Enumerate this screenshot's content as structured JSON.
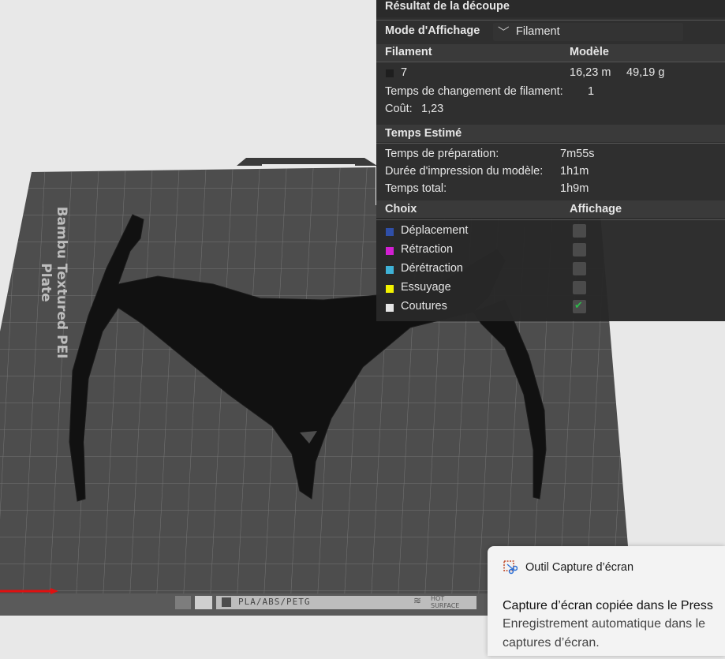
{
  "plate": {
    "label": "Bambu Textured PEI Plate",
    "material_label": "PLA/ABS/PETG",
    "hot_surface_line1": "HOT",
    "hot_surface_line2": "SURFACE"
  },
  "panel": {
    "title": "Résultat de la découpe",
    "mode_label": "Mode d'Affichage",
    "mode_value": "Filament",
    "filament_header": "Filament",
    "model_header": "Modèle",
    "filament_id": "7",
    "filament_color": "#1e1e1e",
    "filament_length": "16,23 m",
    "filament_weight": "49,19 g",
    "change_time_label": "Temps de changement de filament:",
    "change_time_value": "1",
    "cost_label": "Coût:",
    "cost_value": "1,23",
    "estimated_header": "Temps Estimé",
    "prep_label": "Temps de préparation:",
    "prep_value": "7m55s",
    "print_label": "Durée d'impression du modèle:",
    "print_value": "1h1m",
    "total_label": "Temps total:",
    "total_value": "1h9m",
    "choice_header": "Choix",
    "display_header": "Affichage",
    "options": [
      {
        "label": "Déplacement",
        "color": "#2f4fa8",
        "checked": false
      },
      {
        "label": "Rétraction",
        "color": "#d21fd2",
        "checked": false
      },
      {
        "label": "Dérétraction",
        "color": "#3fb2d6",
        "checked": false
      },
      {
        "label": "Essuyage",
        "color": "#f2f200",
        "checked": false
      },
      {
        "label": "Coutures",
        "color": "#e6e6e6",
        "checked": true
      }
    ]
  },
  "toast": {
    "app_name": "Outil Capture d’écran",
    "line1": "Capture d’écran copiée dans le Press",
    "line2": "Enregistrement automatique dans le",
    "line3": "captures d’écran."
  }
}
